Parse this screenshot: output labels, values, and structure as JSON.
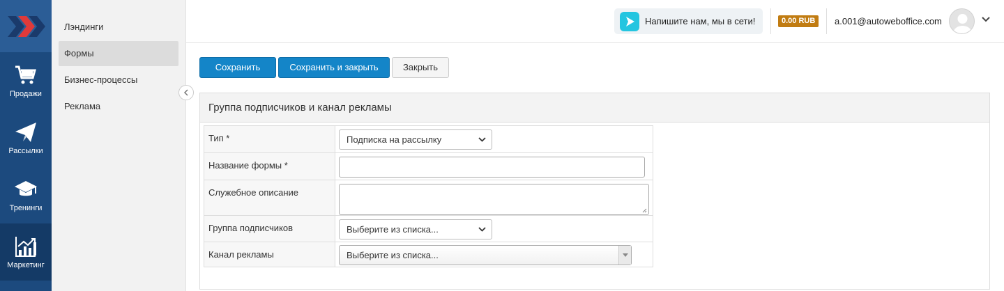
{
  "rail": {
    "items": [
      {
        "label": "Продажи",
        "icon": "cart-icon"
      },
      {
        "label": "Рассылки",
        "icon": "paper-plane-icon"
      },
      {
        "label": "Тренинги",
        "icon": "graduation-cap-icon"
      },
      {
        "label": "Маркетинг",
        "icon": "chart-growth-icon",
        "active": true
      }
    ]
  },
  "submenu": {
    "items": [
      "Лэндинги",
      "Формы",
      "Бизнес-процессы",
      "Реклама"
    ],
    "active": "Формы"
  },
  "header": {
    "chat_label": "Напишите нам, мы в сети!",
    "balance": "0.00 RUB",
    "user_email": "a.001@autoweboffice.com"
  },
  "toolbar": {
    "save_label": "Сохранить",
    "save_close_label": "Сохранить и закрыть",
    "close_label": "Закрыть"
  },
  "panel": {
    "title": "Группа подписчиков и канал рекламы",
    "fields": {
      "type_label": "Тип *",
      "type_value": "Подписка на рассылку",
      "form_name_label": "Название формы *",
      "form_name_value": "",
      "description_label": "Служебное описание",
      "description_value": "",
      "group_label": "Группа подписчиков",
      "group_value": "Выберите из списка...",
      "channel_label": "Канал рекламы",
      "channel_value": "Выберите из списка..."
    }
  },
  "colors": {
    "rail_bg": "#1c4a7e",
    "primary": "#1485c8",
    "balance_badge": "#c17c12",
    "chat_icon": "#24c5e0",
    "logo_red": "#e03a3a"
  }
}
